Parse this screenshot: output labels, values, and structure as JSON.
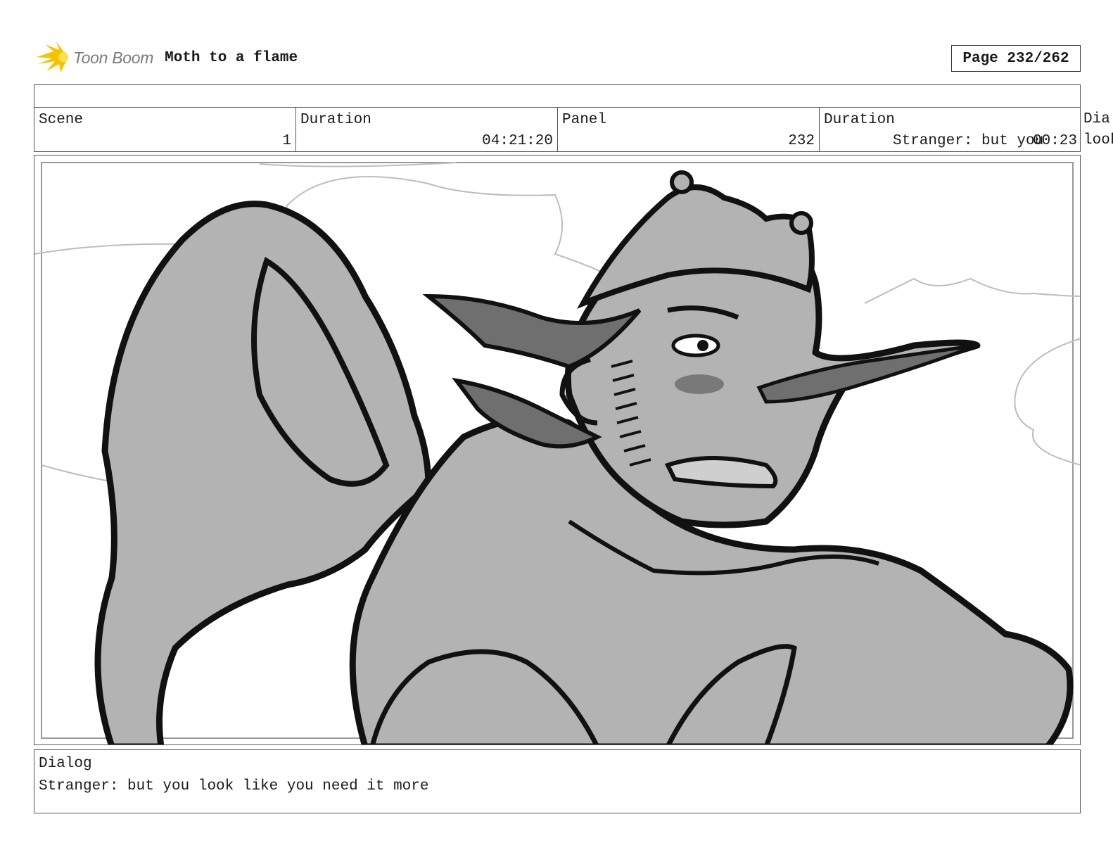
{
  "header": {
    "logo_text": "Toon Boom",
    "project_title": "Moth to a flame",
    "page_label": "Page 232/262"
  },
  "info": {
    "scene_label": "Scene",
    "scene_value": "1",
    "scene_duration_label": "Duration",
    "scene_duration_value": "04:21:20",
    "panel_label": "Panel",
    "panel_value": "232",
    "panel_duration_label": "Duration",
    "panel_duration_value": "00:23",
    "dialog_overflow_label": "Dia",
    "dialog_overflow_text": "Stranger: but you",
    "dialog_overflow_tail": "look"
  },
  "dialog": {
    "label": "Dialog",
    "text": "Stranger: but you look like you need it more"
  },
  "colors": {
    "sketch_fill": "#b3b3b3",
    "sketch_dark": "#6f6f6f",
    "ink": "#111111",
    "logo_yellow": "#f5c400"
  }
}
